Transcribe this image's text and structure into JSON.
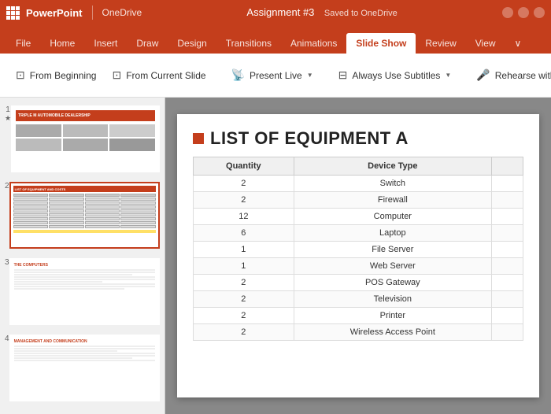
{
  "titlebar": {
    "app_name": "PowerPoint",
    "service": "OneDrive",
    "doc_title": "Assignment #3",
    "save_status": "Saved to OneDrive"
  },
  "ribbon": {
    "tabs": [
      {
        "label": "File",
        "active": false
      },
      {
        "label": "Home",
        "active": false
      },
      {
        "label": "Insert",
        "active": false
      },
      {
        "label": "Draw",
        "active": false
      },
      {
        "label": "Design",
        "active": false
      },
      {
        "label": "Transitions",
        "active": false
      },
      {
        "label": "Animations",
        "active": false
      },
      {
        "label": "Slide Show",
        "active": true
      },
      {
        "label": "Review",
        "active": false
      },
      {
        "label": "View",
        "active": false
      }
    ],
    "commands": [
      {
        "id": "from-beginning",
        "label": "From Beginning",
        "icon": "▶"
      },
      {
        "id": "from-current",
        "label": "From Current Slide",
        "icon": "▶"
      },
      {
        "id": "present-live",
        "label": "Present Live",
        "icon": "📡",
        "dropdown": true
      },
      {
        "id": "always-subtitles",
        "label": "Always Use Subtitles",
        "icon": "CC",
        "dropdown": true
      },
      {
        "id": "rehearse-coach",
        "label": "Rehearse with Coach",
        "icon": "🎤"
      }
    ]
  },
  "slides": [
    {
      "num": "1",
      "title": "TRIPLE M AUTOMOBILE DEALERSHIP",
      "selected": false,
      "star": true
    },
    {
      "num": "2",
      "title": "LIST OF EQUIPMENT AND COSTS",
      "selected": true,
      "star": false
    },
    {
      "num": "3",
      "title": "THE COMPUTERS",
      "selected": false,
      "star": false
    },
    {
      "num": "4",
      "title": "MANAGEMENT AND COMMUNICATION",
      "selected": false,
      "star": false
    }
  ],
  "main_slide": {
    "title": "LIST OF EQUIPMENT A",
    "table": {
      "headers": [
        "Quantity",
        "Device Type",
        ""
      ],
      "rows": [
        {
          "qty": "2",
          "device": "Switch"
        },
        {
          "qty": "2",
          "device": "Firewall"
        },
        {
          "qty": "12",
          "device": "Computer"
        },
        {
          "qty": "6",
          "device": "Laptop"
        },
        {
          "qty": "1",
          "device": "File Server"
        },
        {
          "qty": "1",
          "device": "Web Server"
        },
        {
          "qty": "2",
          "device": "POS Gateway"
        },
        {
          "qty": "2",
          "device": "Television"
        },
        {
          "qty": "2",
          "device": "Printer"
        },
        {
          "qty": "2",
          "device": "Wireless Access Point"
        }
      ]
    }
  }
}
